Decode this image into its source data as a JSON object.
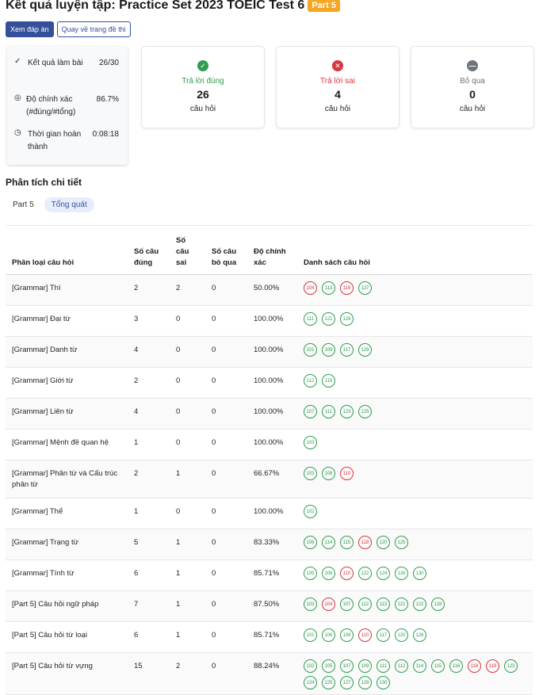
{
  "header": {
    "title": "Kết quả luyện tập: Practice Set 2023 TOEIC Test 6",
    "badge": "Part 5",
    "btn_answers": "Xem đáp án",
    "btn_back": "Quay về trang đề thi"
  },
  "summary": {
    "items": [
      {
        "icon": "check-icon",
        "label": "Kết quả làm bài",
        "value": "26/30"
      },
      {
        "icon": "target-icon",
        "label": "Độ chính xác (#đúng/#tổng)",
        "value": "86.7%"
      },
      {
        "icon": "clock-icon",
        "label": "Thời gian hoàn thành",
        "value": "0:08:18"
      }
    ]
  },
  "stats": [
    {
      "label": "Trả lời đúng",
      "value": "26",
      "unit": "câu hỏi",
      "color": "#2e9e4f",
      "icon": "check-circle-icon",
      "glyph": "✓"
    },
    {
      "label": "Trả lời sai",
      "value": "4",
      "unit": "câu hỏi",
      "color": "#d9363e",
      "icon": "x-circle-icon",
      "glyph": "✕"
    },
    {
      "label": "Bỏ qua",
      "value": "0",
      "unit": "câu hỏi",
      "color": "#6c757d",
      "icon": "minus-circle-icon",
      "glyph": "—"
    }
  ],
  "section_title": "Phân tích chi tiết",
  "tabs": [
    "Part 5",
    "Tổng quát"
  ],
  "table": {
    "headers": {
      "category": "Phân loại câu hỏi",
      "correct": "Số câu đúng",
      "wrong": "Số câu sai",
      "skipped": "Số câu bỏ qua",
      "accuracy": "Độ chính xác",
      "list": "Danh sách câu hỏi"
    },
    "rows": [
      {
        "category": "[Grammar] Thì",
        "correct": "2",
        "wrong": "2",
        "skipped": "0",
        "accuracy": "50.00%",
        "questions": [
          {
            "n": "104",
            "ok": false
          },
          {
            "n": "113",
            "ok": true
          },
          {
            "n": "119",
            "ok": false
          },
          {
            "n": "127",
            "ok": true
          }
        ]
      },
      {
        "category": "[Grammar] Đại từ",
        "correct": "3",
        "wrong": "0",
        "skipped": "0",
        "accuracy": "100.00%",
        "questions": [
          {
            "n": "111",
            "ok": true
          },
          {
            "n": "121",
            "ok": true
          },
          {
            "n": "128",
            "ok": true
          }
        ]
      },
      {
        "category": "[Grammar] Danh từ",
        "correct": "4",
        "wrong": "0",
        "skipped": "0",
        "accuracy": "100.00%",
        "questions": [
          {
            "n": "101",
            "ok": true
          },
          {
            "n": "109",
            "ok": true
          },
          {
            "n": "117",
            "ok": true
          },
          {
            "n": "129",
            "ok": true
          }
        ]
      },
      {
        "category": "[Grammar] Giới từ",
        "correct": "2",
        "wrong": "0",
        "skipped": "0",
        "accuracy": "100.00%",
        "questions": [
          {
            "n": "112",
            "ok": true
          },
          {
            "n": "115",
            "ok": true
          }
        ]
      },
      {
        "category": "[Grammar] Liên từ",
        "correct": "4",
        "wrong": "0",
        "skipped": "0",
        "accuracy": "100.00%",
        "questions": [
          {
            "n": "107",
            "ok": true
          },
          {
            "n": "111",
            "ok": true
          },
          {
            "n": "123",
            "ok": true
          },
          {
            "n": "125",
            "ok": true
          }
        ]
      },
      {
        "category": "[Grammar] Mệnh đề quan hệ",
        "correct": "1",
        "wrong": "0",
        "skipped": "0",
        "accuracy": "100.00%",
        "questions": [
          {
            "n": "103",
            "ok": true
          }
        ]
      },
      {
        "category": "[Grammar] Phân từ và Cấu trúc phân từ",
        "correct": "2",
        "wrong": "1",
        "skipped": "0",
        "accuracy": "66.67%",
        "questions": [
          {
            "n": "103",
            "ok": true
          },
          {
            "n": "108",
            "ok": true
          },
          {
            "n": "110",
            "ok": false
          }
        ]
      },
      {
        "category": "[Grammar] Thể",
        "correct": "1",
        "wrong": "0",
        "skipped": "0",
        "accuracy": "100.00%",
        "questions": [
          {
            "n": "102",
            "ok": true
          }
        ]
      },
      {
        "category": "[Grammar] Trạng từ",
        "correct": "5",
        "wrong": "1",
        "skipped": "0",
        "accuracy": "83.33%",
        "questions": [
          {
            "n": "106",
            "ok": true
          },
          {
            "n": "114",
            "ok": true
          },
          {
            "n": "115",
            "ok": true
          },
          {
            "n": "118",
            "ok": false
          },
          {
            "n": "120",
            "ok": true
          },
          {
            "n": "125",
            "ok": true
          }
        ]
      },
      {
        "category": "[Grammar] Tính từ",
        "correct": "6",
        "wrong": "1",
        "skipped": "0",
        "accuracy": "85.71%",
        "questions": [
          {
            "n": "105",
            "ok": true
          },
          {
            "n": "108",
            "ok": true
          },
          {
            "n": "110",
            "ok": false
          },
          {
            "n": "122",
            "ok": true
          },
          {
            "n": "124",
            "ok": true
          },
          {
            "n": "126",
            "ok": true
          },
          {
            "n": "130",
            "ok": true
          }
        ]
      },
      {
        "category": "[Part 5] Câu hỏi ngữ pháp",
        "correct": "7",
        "wrong": "1",
        "skipped": "0",
        "accuracy": "87.50%",
        "questions": [
          {
            "n": "103",
            "ok": true
          },
          {
            "n": "104",
            "ok": false
          },
          {
            "n": "107",
            "ok": true
          },
          {
            "n": "112",
            "ok": true
          },
          {
            "n": "113",
            "ok": true
          },
          {
            "n": "121",
            "ok": true
          },
          {
            "n": "122",
            "ok": true
          },
          {
            "n": "128",
            "ok": true
          }
        ]
      },
      {
        "category": "[Part 5] Câu hỏi từ loại",
        "correct": "6",
        "wrong": "1",
        "skipped": "0",
        "accuracy": "85.71%",
        "questions": [
          {
            "n": "101",
            "ok": true
          },
          {
            "n": "106",
            "ok": true
          },
          {
            "n": "108",
            "ok": true
          },
          {
            "n": "110",
            "ok": false
          },
          {
            "n": "117",
            "ok": true
          },
          {
            "n": "120",
            "ok": true
          },
          {
            "n": "126",
            "ok": true
          }
        ]
      },
      {
        "category": "[Part 5] Câu hỏi từ vựng",
        "correct": "15",
        "wrong": "2",
        "skipped": "0",
        "accuracy": "88.24%",
        "questions": [
          {
            "n": "102",
            "ok": true
          },
          {
            "n": "105",
            "ok": true
          },
          {
            "n": "107",
            "ok": true
          },
          {
            "n": "109",
            "ok": true
          },
          {
            "n": "111",
            "ok": true
          },
          {
            "n": "112",
            "ok": true
          },
          {
            "n": "114",
            "ok": true
          },
          {
            "n": "115",
            "ok": true
          },
          {
            "n": "116",
            "ok": true
          },
          {
            "n": "118",
            "ok": false
          },
          {
            "n": "119",
            "ok": false
          },
          {
            "n": "123",
            "ok": true
          },
          {
            "n": "124",
            "ok": true
          },
          {
            "n": "125",
            "ok": true
          },
          {
            "n": "127",
            "ok": true
          },
          {
            "n": "129",
            "ok": true
          },
          {
            "n": "130",
            "ok": true
          }
        ]
      }
    ]
  }
}
